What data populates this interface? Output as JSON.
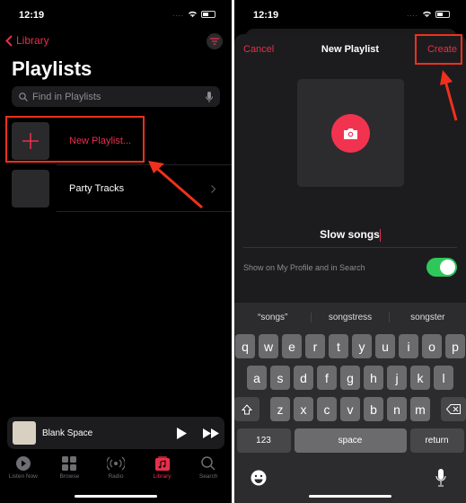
{
  "left": {
    "status": {
      "time": "12:19"
    },
    "nav": {
      "back_label": "Library"
    },
    "title": "Playlists",
    "search": {
      "placeholder": "Find in Playlists"
    },
    "rows": [
      {
        "label": "New Playlist..."
      },
      {
        "label": "Party Tracks"
      }
    ],
    "mini_player": {
      "song": "Blank Space"
    },
    "tabs": [
      {
        "label": "Listen Now"
      },
      {
        "label": "Browse"
      },
      {
        "label": "Radio"
      },
      {
        "label": "Library",
        "active": true
      },
      {
        "label": "Search"
      }
    ]
  },
  "right": {
    "status": {
      "time": "12:19"
    },
    "nav": {
      "cancel": "Cancel",
      "title": "New Playlist",
      "create": "Create"
    },
    "playlist_name": "Slow songs",
    "toggle": {
      "label": "Show on My Profile and in Search",
      "on": true
    },
    "suggestions": [
      "“songs”",
      "songstress",
      "songster"
    ],
    "keyboard": {
      "row1": [
        "q",
        "w",
        "e",
        "r",
        "t",
        "y",
        "u",
        "i",
        "o",
        "p"
      ],
      "row2": [
        "a",
        "s",
        "d",
        "f",
        "g",
        "h",
        "j",
        "k",
        "l"
      ],
      "row3": [
        "z",
        "x",
        "c",
        "v",
        "b",
        "n",
        "m"
      ],
      "numbers": "123",
      "space": "space",
      "return": "return"
    }
  },
  "colors": {
    "accent": "#e6304b",
    "highlight": "#f0301c",
    "toggle_on": "#30c75a"
  }
}
